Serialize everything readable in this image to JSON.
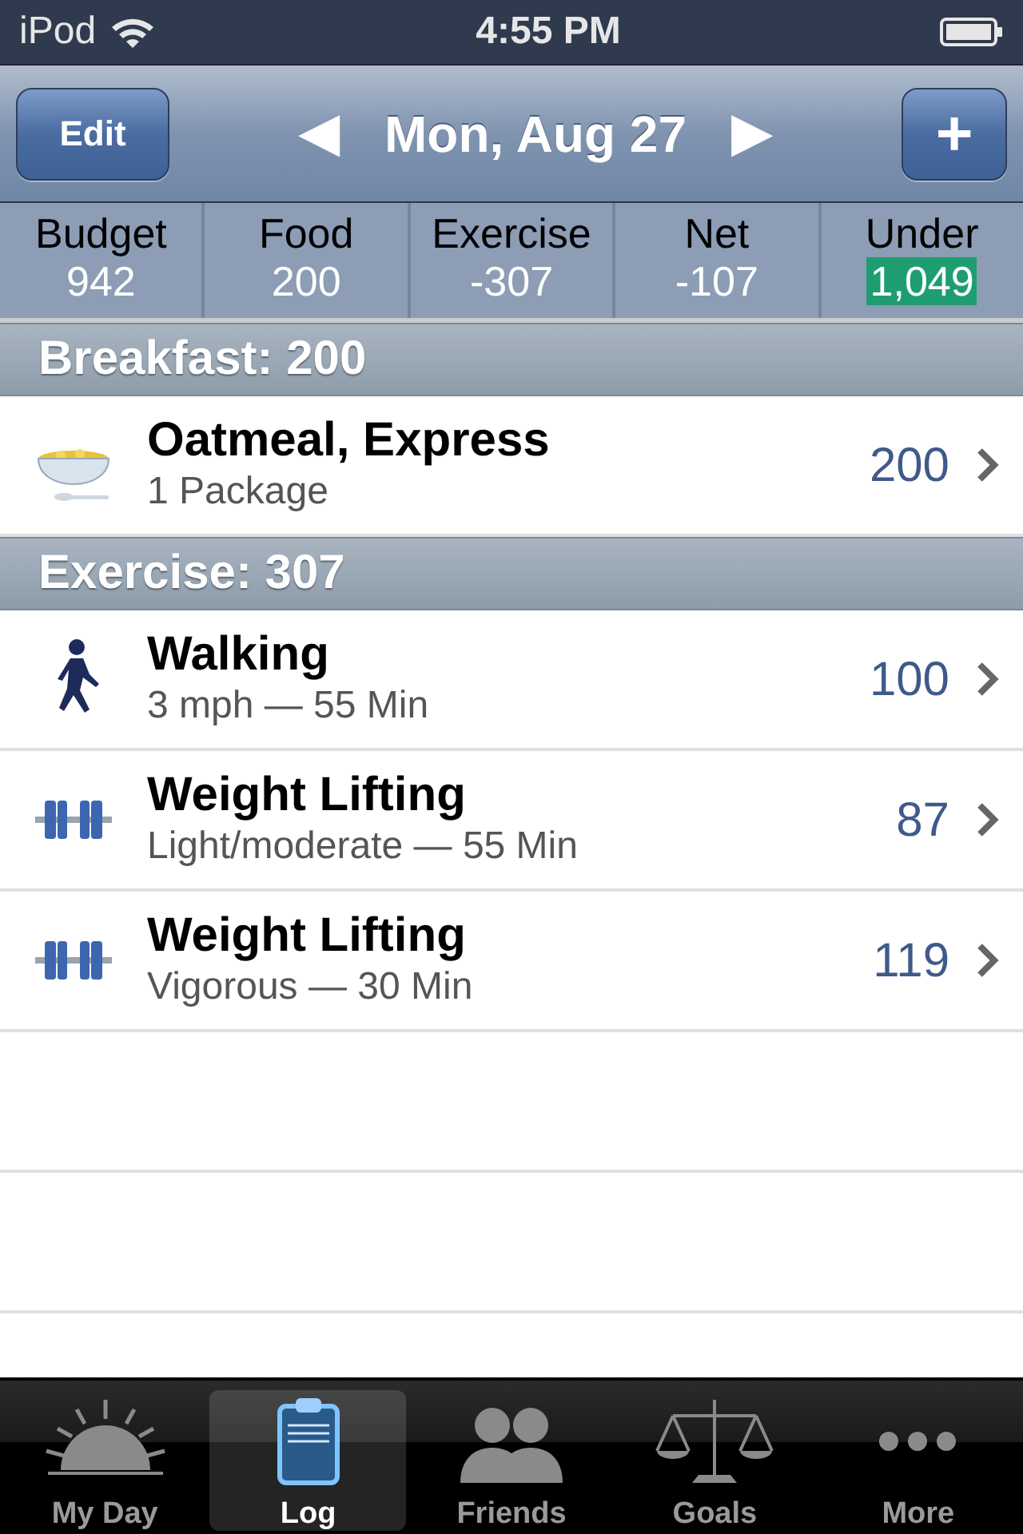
{
  "status_bar": {
    "carrier": "iPod",
    "time": "4:55 PM"
  },
  "nav": {
    "left_button": "Edit",
    "date": "Mon, Aug 27",
    "prev": "◀",
    "next": "▶",
    "right_button": "+"
  },
  "summary": [
    {
      "label": "Budget",
      "value": "942",
      "highlight": false
    },
    {
      "label": "Food",
      "value": "200",
      "highlight": false
    },
    {
      "label": "Exercise",
      "value": "-307",
      "highlight": false
    },
    {
      "label": "Net",
      "value": "-107",
      "highlight": false
    },
    {
      "label": "Under",
      "value": "1,049",
      "highlight": true
    }
  ],
  "sections": [
    {
      "title": "Breakfast: 200",
      "items": [
        {
          "kind": "food",
          "name": "Oatmeal, Express",
          "detail": "1 Package",
          "value": "200"
        }
      ]
    },
    {
      "title": "Exercise: 307",
      "items": [
        {
          "kind": "walk",
          "name": "Walking",
          "detail": "3 mph — 55 Min",
          "value": "100"
        },
        {
          "kind": "lift",
          "name": "Weight Lifting",
          "detail": "Light/moderate — 55 Min",
          "value": "87"
        },
        {
          "kind": "lift",
          "name": "Weight Lifting",
          "detail": "Vigorous — 30 Min",
          "value": "119"
        }
      ]
    }
  ],
  "tabs": [
    {
      "kind": "sun",
      "label": "My Day",
      "selected": false
    },
    {
      "kind": "clipboard",
      "label": "Log",
      "selected": true
    },
    {
      "kind": "people",
      "label": "Friends",
      "selected": false
    },
    {
      "kind": "scale",
      "label": "Goals",
      "selected": false
    },
    {
      "kind": "dots",
      "label": "More",
      "selected": false
    }
  ]
}
